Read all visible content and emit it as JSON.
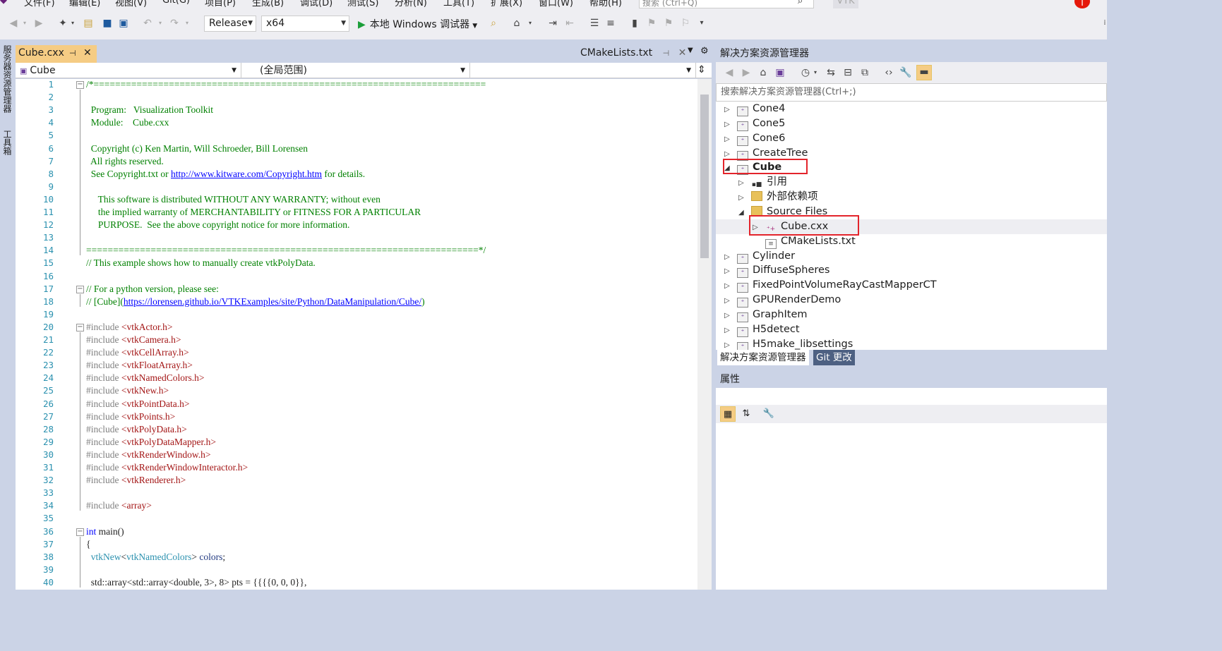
{
  "menu": [
    "文件(F)",
    "编辑(E)",
    "视图(V)",
    "Git(G)",
    "项目(P)",
    "生成(B)",
    "调试(D)",
    "测试(S)",
    "分析(N)",
    "工具(T)",
    "扩展(X)",
    "窗口(W)",
    "帮助(H)"
  ],
  "search": {
    "placeholder": "搜索 (Ctrl+Q)"
  },
  "solution_name": "VTK",
  "user_initial": "T",
  "toolbar": {
    "config": "Release",
    "platform": "x64",
    "run_label": "本地 Windows 调试器"
  },
  "left_strip": {
    "server_explorer": "服务器资源管理器",
    "toolbox": "工具箱"
  },
  "editor": {
    "active_tab": "Cube.cxx",
    "inactive_tab": "CMakeLists.txt",
    "nav_project": "Cube",
    "nav_scope": "(全局范围)",
    "lines": [
      {
        "n": "1",
        "t": "/*=========================================================================",
        "c": "cm"
      },
      {
        "n": "2",
        "t": "",
        "c": "cm"
      },
      {
        "n": "3",
        "t": "  Program:   Visualization Toolkit",
        "c": "cm"
      },
      {
        "n": "4",
        "t": "  Module:    Cube.cxx",
        "c": "cm"
      },
      {
        "n": "5",
        "t": "",
        "c": "cm"
      },
      {
        "n": "6",
        "t": "  Copyright (c) Ken Martin, Will Schroeder, Bill Lorensen",
        "c": "cm"
      },
      {
        "n": "7",
        "t": "  All rights reserved.",
        "c": "cm"
      },
      {
        "n": "8",
        "t": "  See Copyright.txt or http://www.kitware.com/Copyright.htm for details.",
        "c": "cm"
      },
      {
        "n": "9",
        "t": "",
        "c": "cm"
      },
      {
        "n": "10",
        "t": "     This software is distributed WITHOUT ANY WARRANTY; without even",
        "c": "cm"
      },
      {
        "n": "11",
        "t": "     the implied warranty of MERCHANTABILITY or FITNESS FOR A PARTICULAR",
        "c": "cm"
      },
      {
        "n": "12",
        "t": "     PURPOSE.  See the above copyright notice for more information.",
        "c": "cm"
      },
      {
        "n": "13",
        "t": "",
        "c": "cm"
      },
      {
        "n": "14",
        "t": "=========================================================================*/",
        "c": "cm"
      },
      {
        "n": "15",
        "t": "// This example shows how to manually create vtkPolyData.",
        "c": "cm"
      },
      {
        "n": "16",
        "t": "",
        "c": "cm"
      },
      {
        "n": "17",
        "t": "// For a python version, please see:",
        "c": "cm"
      },
      {
        "n": "18",
        "t": "// [Cube](https://lorensen.github.io/VTKExamples/site/Python/DataManipulation/Cube/)",
        "c": "cm"
      },
      {
        "n": "19",
        "t": "",
        "c": "cm"
      },
      {
        "n": "20",
        "t": "#include <vtkActor.h>",
        "c": "inc"
      },
      {
        "n": "21",
        "t": "#include <vtkCamera.h>",
        "c": "inc"
      },
      {
        "n": "22",
        "t": "#include <vtkCellArray.h>",
        "c": "inc"
      },
      {
        "n": "23",
        "t": "#include <vtkFloatArray.h>",
        "c": "inc"
      },
      {
        "n": "24",
        "t": "#include <vtkNamedColors.h>",
        "c": "inc"
      },
      {
        "n": "25",
        "t": "#include <vtkNew.h>",
        "c": "inc"
      },
      {
        "n": "26",
        "t": "#include <vtkPointData.h>",
        "c": "inc"
      },
      {
        "n": "27",
        "t": "#include <vtkPoints.h>",
        "c": "inc"
      },
      {
        "n": "28",
        "t": "#include <vtkPolyData.h>",
        "c": "inc"
      },
      {
        "n": "29",
        "t": "#include <vtkPolyDataMapper.h>",
        "c": "inc"
      },
      {
        "n": "30",
        "t": "#include <vtkRenderWindow.h>",
        "c": "inc"
      },
      {
        "n": "31",
        "t": "#include <vtkRenderWindowInteractor.h>",
        "c": "inc"
      },
      {
        "n": "32",
        "t": "#include <vtkRenderer.h>",
        "c": "inc"
      },
      {
        "n": "33",
        "t": "",
        "c": "inc"
      },
      {
        "n": "34",
        "t": "#include <array>",
        "c": "inc"
      },
      {
        "n": "35",
        "t": "",
        "c": "norm"
      },
      {
        "n": "36",
        "t": "int main()",
        "c": "fn"
      },
      {
        "n": "37",
        "t": "{",
        "c": "norm"
      },
      {
        "n": "38",
        "t": "  vtkNew<vtkNamedColors> colors;",
        "c": "vn"
      },
      {
        "n": "39",
        "t": "",
        "c": "norm"
      },
      {
        "n": "40",
        "t": "  std::array<std::array<double, 3>, 8> pts = {{{{0, 0, 0}},",
        "c": "norm"
      }
    ]
  },
  "solution_explorer": {
    "title": "解决方案资源管理器",
    "search_placeholder": "搜索解决方案资源管理器(Ctrl+;)",
    "items": [
      {
        "label": "Cone4",
        "exp": "▷",
        "bold": false
      },
      {
        "label": "Cone5",
        "exp": "▷",
        "bold": false
      },
      {
        "label": "Cone6",
        "exp": "▷",
        "bold": false
      },
      {
        "label": "CreateTree",
        "exp": "▷",
        "bold": false
      },
      {
        "label": "Cube",
        "exp": "◢",
        "bold": true
      },
      {
        "label": "引用",
        "exp": "▷",
        "bold": false
      },
      {
        "label": "外部依赖项",
        "exp": "▷",
        "bold": false
      },
      {
        "label": "Source Files",
        "exp": "◢",
        "bold": false
      },
      {
        "label": "Cube.cxx",
        "exp": "▷",
        "bold": false
      },
      {
        "label": "CMakeLists.txt",
        "exp": "",
        "bold": false
      },
      {
        "label": "Cylinder",
        "exp": "▷",
        "bold": false
      },
      {
        "label": "DiffuseSpheres",
        "exp": "▷",
        "bold": false
      },
      {
        "label": "FixedPointVolumeRayCastMapperCT",
        "exp": "▷",
        "bold": false
      },
      {
        "label": "GPURenderDemo",
        "exp": "▷",
        "bold": false
      },
      {
        "label": "GraphItem",
        "exp": "▷",
        "bold": false
      },
      {
        "label": "H5detect",
        "exp": "▷",
        "bold": false
      },
      {
        "label": "H5make_libsettings",
        "exp": "▷",
        "bold": false
      }
    ],
    "tab_solution": "解决方案资源管理器",
    "tab_git": "Git 更改"
  },
  "properties": {
    "title": "属性"
  },
  "colors": {
    "accent": "#f5cc84",
    "frame": "#cbd3e6",
    "highlight_box": "#e3242b",
    "comment": "#008000",
    "string_red": "#a31515"
  }
}
